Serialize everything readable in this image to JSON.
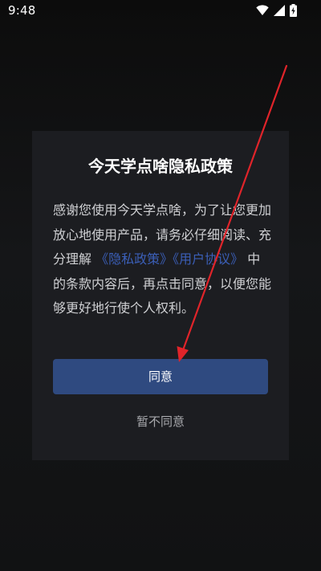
{
  "status_bar": {
    "time": "9:48",
    "icons": [
      "wifi-icon",
      "cellular-signal-icon",
      "battery-charging-icon"
    ]
  },
  "dialog": {
    "title": "今天学点啥隐私政策",
    "body_text_1": "感谢您使用今天学点啥，为了让您更加放心地使用产品，请务必仔细阅读、充分理解",
    "privacy_policy_link": "《隐私政策》",
    "user_agreement_link": "《用户协议》",
    "body_text_2": "中的条款内容后，再点击同意，以便您能够更好地行使个人权利。",
    "agree_label": "同意",
    "decline_label": "暂不同意"
  },
  "colors": {
    "dialog_background": "#1c1d21",
    "agree_button": "#2f4a80",
    "link": "#3b5fb8",
    "annotation_arrow": "#e0242a"
  }
}
